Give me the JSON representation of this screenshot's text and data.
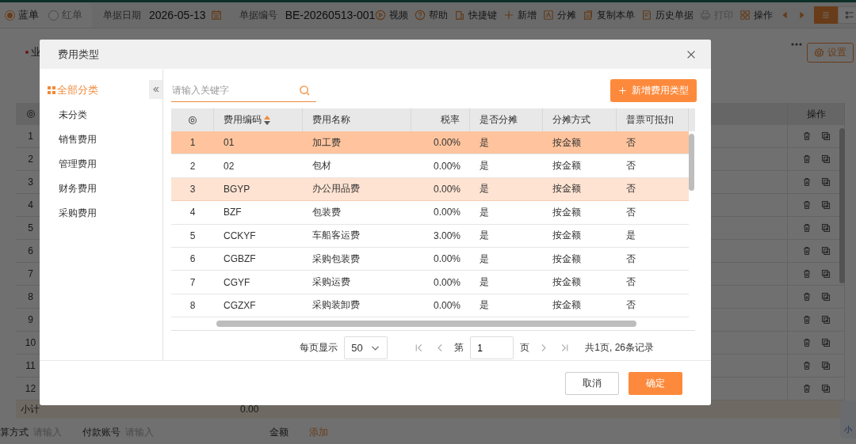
{
  "page": {
    "bill_types": [
      {
        "label": "蓝单",
        "selected": true
      },
      {
        "label": "红单",
        "selected": false
      }
    ],
    "date_label": "单据日期",
    "date": "2026-05-13",
    "number_label": "单据编号",
    "number": "BE-20260513-001",
    "actions": [
      {
        "label": "视频",
        "disabled": false
      },
      {
        "label": "帮助",
        "disabled": false
      },
      {
        "label": "快捷键",
        "disabled": false
      },
      {
        "label": "新增",
        "disabled": false
      },
      {
        "label": "分摊",
        "disabled": false
      },
      {
        "label": "复制本单",
        "disabled": false
      },
      {
        "label": "历史单据",
        "disabled": false
      },
      {
        "label": "打印",
        "disabled": true
      },
      {
        "label": "操作",
        "disabled": false
      }
    ],
    "field_label": "业",
    "settings": "设置",
    "grid": {
      "op_header": "操作",
      "rows": [
        "1",
        "2",
        "3",
        "4",
        "5",
        "6",
        "7",
        "8",
        "9",
        "10",
        "11",
        "12"
      ],
      "subtotal_label": "小计",
      "subtotal": "0.00"
    },
    "bottom_fields": [
      {
        "label": "算方式",
        "placeholder": "请输入"
      },
      {
        "label": "付款账号",
        "placeholder": "请输入"
      }
    ],
    "amount_label": "金额",
    "add": "添加",
    "assistant": "小"
  },
  "modal": {
    "title": "费用类型",
    "tree": {
      "label": "全部分类",
      "selected": true,
      "children": [
        {
          "label": "未分类",
          "selected": false
        },
        {
          "label": "销售费用",
          "selected": false
        },
        {
          "label": "管理费用",
          "selected": false
        },
        {
          "label": "财务费用",
          "selected": false
        },
        {
          "label": "采购费用",
          "selected": false
        }
      ]
    },
    "search": {
      "placeholder": "请输入关键字"
    },
    "new_button": "新增费用类型",
    "table": {
      "columns": [
        "费用编码",
        "费用名称",
        "税率",
        "是否分摊",
        "分摊方式",
        "普票可抵扣"
      ],
      "rows": [
        {
          "no": "1",
          "code": "01",
          "name": "加工费",
          "rate": "0.00%",
          "share": "是",
          "method": "按金额",
          "deductible": "否",
          "selected": true,
          "highlighted": false
        },
        {
          "no": "2",
          "code": "02",
          "name": "包材",
          "rate": "0.00%",
          "share": "是",
          "method": "按金额",
          "deductible": "否",
          "selected": false,
          "highlighted": false
        },
        {
          "no": "3",
          "code": "BGYP",
          "name": "办公用品费",
          "rate": "0.00%",
          "share": "是",
          "method": "按金额",
          "deductible": "否",
          "selected": false,
          "highlighted": true
        },
        {
          "no": "4",
          "code": "BZF",
          "name": "包装费",
          "rate": "0.00%",
          "share": "是",
          "method": "按金额",
          "deductible": "否",
          "selected": false,
          "highlighted": false
        },
        {
          "no": "5",
          "code": "CCKYF",
          "name": "车船客运费",
          "rate": "3.00%",
          "share": "是",
          "method": "按金额",
          "deductible": "是",
          "selected": false,
          "highlighted": false
        },
        {
          "no": "6",
          "code": "CGBZF",
          "name": "采购包装费",
          "rate": "0.00%",
          "share": "是",
          "method": "按金额",
          "deductible": "否",
          "selected": false,
          "highlighted": false
        },
        {
          "no": "7",
          "code": "CGYF",
          "name": "采购运费",
          "rate": "0.00%",
          "share": "是",
          "method": "按金额",
          "deductible": "否",
          "selected": false,
          "highlighted": false
        },
        {
          "no": "8",
          "code": "CGZXF",
          "name": "采购装卸费",
          "rate": "0.00%",
          "share": "是",
          "method": "按金额",
          "deductible": "否",
          "selected": false,
          "highlighted": false
        }
      ]
    },
    "pagination": {
      "size_label": "每页显示",
      "page_size": "50",
      "page_prefix": "第",
      "page": "1",
      "page_suffix": "页",
      "summary": "共1页, 26条记录"
    },
    "buttons": {
      "cancel": "取消",
      "ok": "确定"
    }
  }
}
